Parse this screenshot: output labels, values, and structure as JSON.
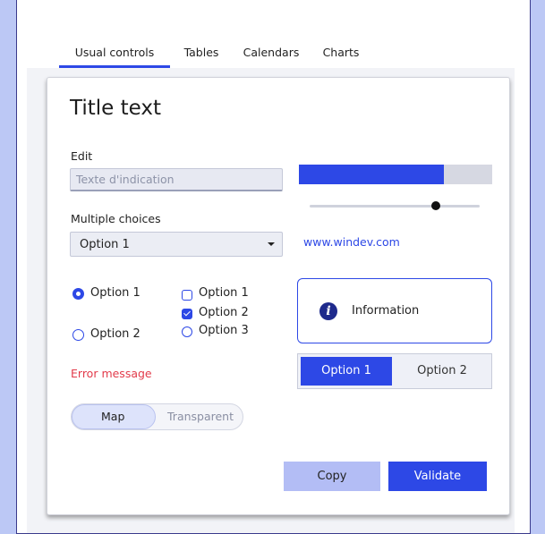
{
  "tabs": [
    {
      "label": "Usual controls",
      "active": true
    },
    {
      "label": "Tables",
      "active": false
    },
    {
      "label": "Calendars",
      "active": false
    },
    {
      "label": "Charts",
      "active": false
    }
  ],
  "title": "Title text",
  "edit": {
    "label": "Edit",
    "placeholder": "Texte d'indication"
  },
  "combo": {
    "label": "Multiple choices",
    "value": "Option 1"
  },
  "radios": [
    {
      "label": "Option 1",
      "checked": true
    },
    {
      "label": "Option 2",
      "checked": false
    }
  ],
  "checkboxes": [
    {
      "label": "Option 1",
      "checked": false
    },
    {
      "label": "Option 2",
      "checked": true
    },
    {
      "label": "Option 3",
      "checked": false
    }
  ],
  "error_message": "Error message",
  "switch": {
    "left": "Map",
    "right": "Transparent",
    "selected": "Map"
  },
  "progress": {
    "value_percent": 75
  },
  "slider": {
    "value_percent": 74
  },
  "link": "www.windev.com",
  "info": {
    "icon": "info-icon",
    "text": "Information"
  },
  "segment": {
    "options": [
      "Option 1",
      "Option 2"
    ],
    "selected": "Option 1"
  },
  "buttons": {
    "copy": "Copy",
    "validate": "Validate"
  },
  "colors": {
    "accent": "#2d48e6",
    "error": "#e23a4a",
    "background": "#bcc8f5"
  }
}
